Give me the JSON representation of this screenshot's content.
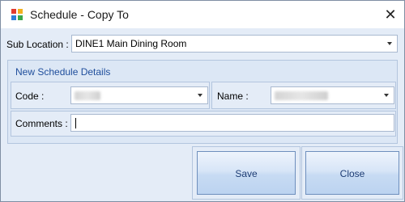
{
  "window": {
    "title": "Schedule - Copy To",
    "close_glyph": "✕"
  },
  "sub_location": {
    "label": "Sub Location :",
    "value": "DINE1 Main Dining Room"
  },
  "group": {
    "caption": "New Schedule Details"
  },
  "code": {
    "label": "Code :",
    "value": ""
  },
  "name": {
    "label": "Name :",
    "value": ""
  },
  "comments": {
    "label": "Comments :",
    "value": ""
  },
  "buttons": {
    "save": "Save",
    "close": "Close"
  },
  "colors": {
    "accent": "#1f4e9c",
    "panel": "#e4ecf7",
    "border": "#b3c5de"
  }
}
